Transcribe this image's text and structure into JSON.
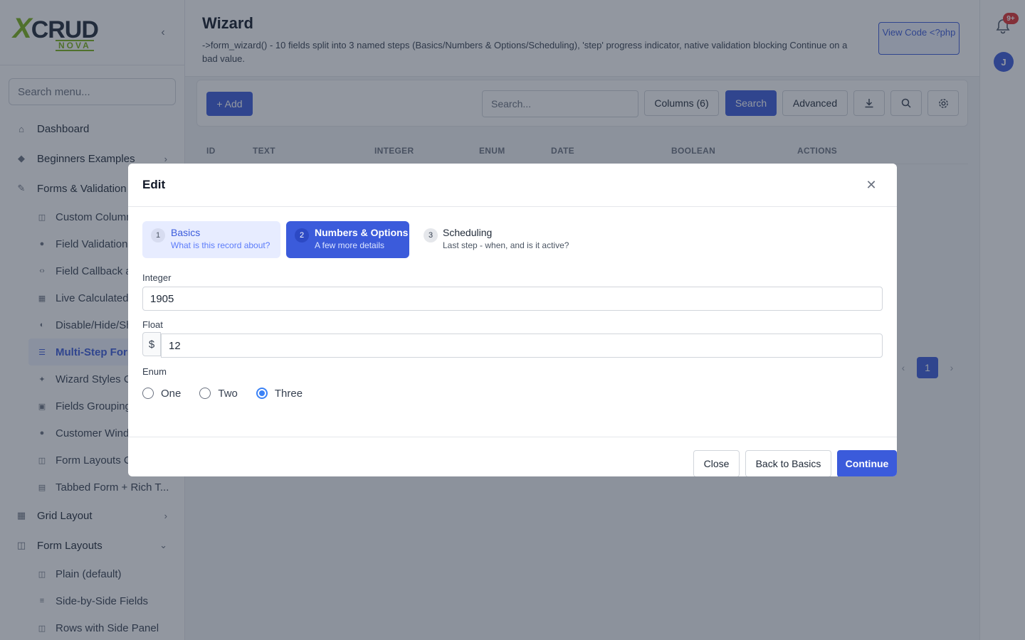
{
  "sidebar": {
    "logo": {
      "main": "XCRUD",
      "sub": "NOVA"
    },
    "search_placeholder": "Search menu...",
    "items": [
      {
        "label": "Dashboard",
        "icon": "home-icon"
      },
      {
        "label": "Beginners Examples",
        "icon": "graduation-cap-icon"
      },
      {
        "label": "Forms & Validation",
        "icon": "edit-icon"
      }
    ],
    "forms_sub": [
      {
        "label": "Custom Columns",
        "icon": "columns-icon"
      },
      {
        "label": "Field Validation",
        "icon": "check-circle-icon"
      },
      {
        "label": "Field Callback a",
        "icon": "code-icon"
      },
      {
        "label": "Live Calculated",
        "icon": "calculator-icon"
      },
      {
        "label": "Disable/Hide/Sh",
        "icon": "toggle-icon"
      },
      {
        "label": "Multi-Step Form",
        "icon": "list-icon"
      },
      {
        "label": "Wizard Styles C",
        "icon": "wand-icon"
      },
      {
        "label": "Fields Grouping",
        "icon": "group-icon"
      },
      {
        "label": "Customer Wind",
        "icon": "user-icon"
      },
      {
        "label": "Form Layouts C",
        "icon": "columns-icon"
      },
      {
        "label": "Tabbed Form + Rich T...",
        "icon": "file-icon"
      }
    ],
    "grid_layout": "Grid Layout",
    "form_layouts": "Form Layouts",
    "form_layouts_sub": [
      {
        "label": "Plain (default)",
        "icon": "columns-icon"
      },
      {
        "label": "Side-by-Side Fields",
        "icon": "bars-icon"
      },
      {
        "label": "Rows with Side Panel",
        "icon": "columns-icon"
      }
    ]
  },
  "header": {
    "title": "Wizard",
    "description": "->form_wizard() - 10 fields split into 3 named steps (Basics/Numbers & Options/Scheduling), 'step' progress indicator, native validation blocking Continue on a bad value.",
    "view_code": "View Code <?php"
  },
  "toolbar": {
    "add": "+ Add",
    "search_placeholder": "Search...",
    "columns": "Columns (6)",
    "search": "Search",
    "advanced": "Advanced"
  },
  "table": {
    "headers": [
      "ID",
      "TEXT",
      "INTEGER",
      "ENUM",
      "DATE",
      "BOOLEAN",
      "ACTIONS"
    ]
  },
  "pagination": {
    "prev": "‹",
    "current": "1",
    "next": "›"
  },
  "rail": {
    "badge": "9+",
    "avatar": "J"
  },
  "modal": {
    "title": "Edit",
    "steps": [
      {
        "num": "1",
        "title": "Basics",
        "subtitle": "What is this record about?"
      },
      {
        "num": "2",
        "title": "Numbers & Options",
        "subtitle": "A few more details"
      },
      {
        "num": "3",
        "title": "Scheduling",
        "subtitle": "Last step - when, and is it active?"
      }
    ],
    "fields": {
      "integer": {
        "label": "Integer",
        "value": "1905"
      },
      "float": {
        "label": "Float",
        "prefix": "$",
        "value": "12"
      },
      "enum": {
        "label": "Enum",
        "options": [
          "One",
          "Two",
          "Three"
        ],
        "selected": "Three"
      }
    },
    "footer": {
      "close": "Close",
      "back": "Back to Basics",
      "continue": "Continue"
    }
  },
  "colors": {
    "accent": "#3b5bdb",
    "logo_green": "#7ab317",
    "badge": "#e03131"
  }
}
